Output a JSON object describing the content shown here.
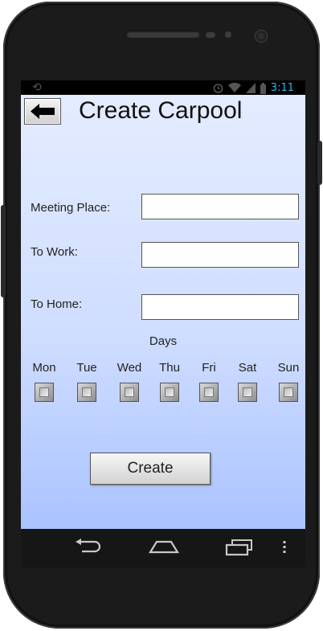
{
  "status_bar": {
    "time": "3:11"
  },
  "header": {
    "title": "Create Carpool"
  },
  "form": {
    "meeting_place_label": "Meeting Place:",
    "meeting_place_value": "",
    "to_work_label": "To Work:",
    "to_work_value": "",
    "to_home_label": "To Home:",
    "to_home_value": ""
  },
  "days": {
    "title": "Days",
    "items": [
      {
        "label": "Mon",
        "checked": false
      },
      {
        "label": "Tue",
        "checked": false
      },
      {
        "label": "Wed",
        "checked": false
      },
      {
        "label": "Thu",
        "checked": false
      },
      {
        "label": "Fri",
        "checked": false
      },
      {
        "label": "Sat",
        "checked": false
      },
      {
        "label": "Sun",
        "checked": false
      }
    ]
  },
  "actions": {
    "create_label": "Create"
  },
  "colors": {
    "screen_top": "#e4ecff",
    "screen_bottom": "#aac3ff",
    "status_time": "#33b5e5"
  },
  "icons": [
    "back-arrow-icon",
    "alarm-icon",
    "wifi-icon",
    "signal-icon",
    "battery-icon",
    "nav-back-icon",
    "nav-home-icon",
    "nav-recents-icon",
    "nav-menu-icon"
  ]
}
